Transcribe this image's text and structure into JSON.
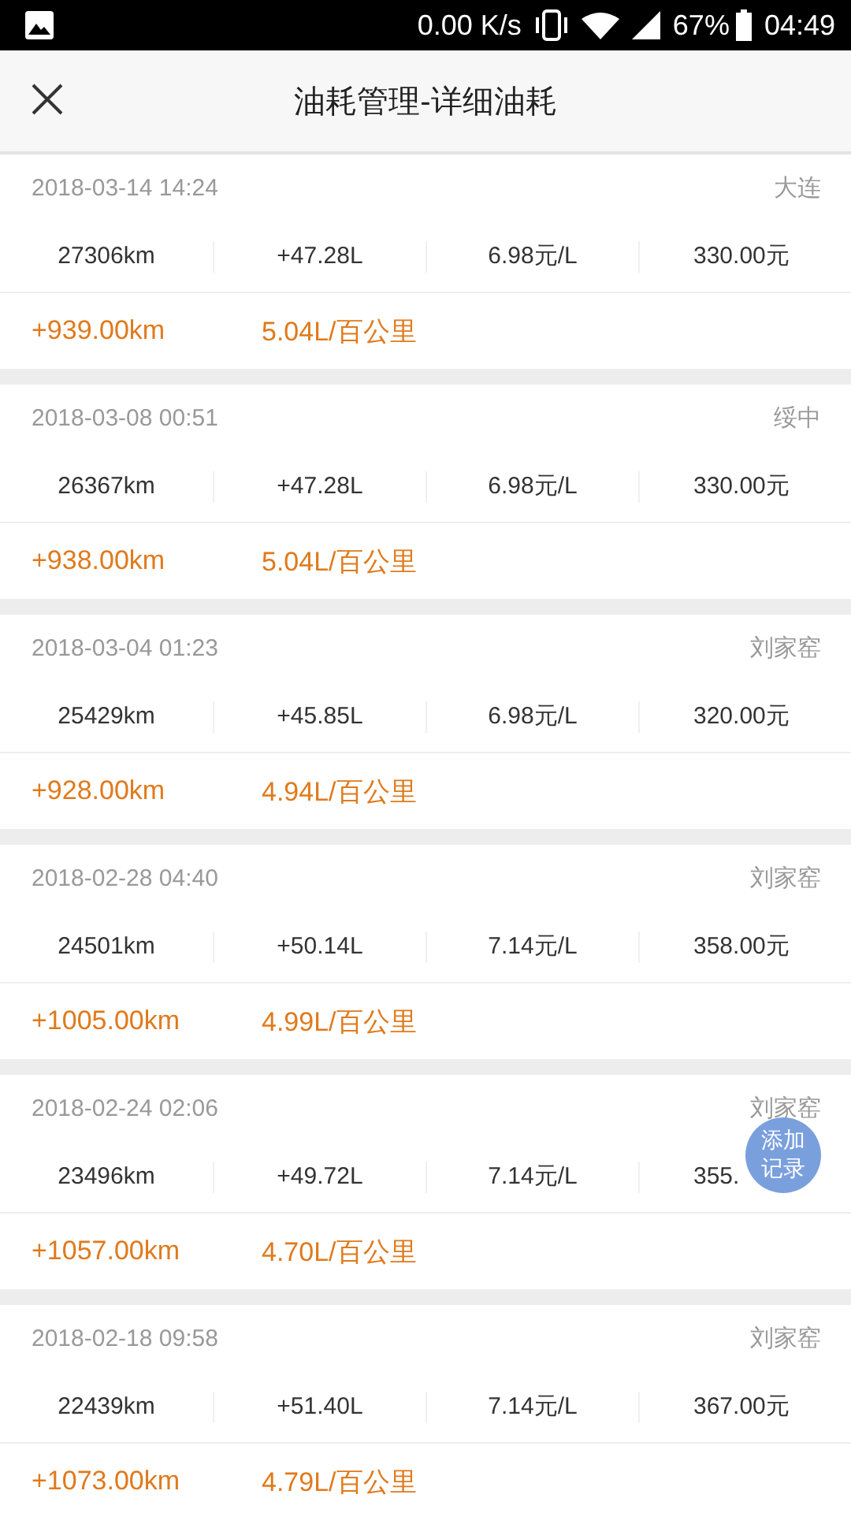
{
  "status_bar": {
    "speed": "0.00 K/s",
    "battery": "67%",
    "time": "04:49"
  },
  "header": {
    "title": "油耗管理-详细油耗"
  },
  "records": [
    {
      "datetime": "2018-03-14 14:24",
      "place": "大连",
      "odometer": "27306km",
      "fuel": "+47.28L",
      "price": "6.98元/L",
      "amount": "330.00元",
      "distance": "+939.00km",
      "consumption": "5.04L/百公里"
    },
    {
      "datetime": "2018-03-08 00:51",
      "place": "绥中",
      "odometer": "26367km",
      "fuel": "+47.28L",
      "price": "6.98元/L",
      "amount": "330.00元",
      "distance": "+938.00km",
      "consumption": "5.04L/百公里"
    },
    {
      "datetime": "2018-03-04 01:23",
      "place": "刘家窑",
      "odometer": "25429km",
      "fuel": "+45.85L",
      "price": "6.98元/L",
      "amount": "320.00元",
      "distance": "+928.00km",
      "consumption": "4.94L/百公里"
    },
    {
      "datetime": "2018-02-28 04:40",
      "place": "刘家窑",
      "odometer": "24501km",
      "fuel": "+50.14L",
      "price": "7.14元/L",
      "amount": "358.00元",
      "distance": "+1005.00km",
      "consumption": "4.99L/百公里"
    },
    {
      "datetime": "2018-02-24 02:06",
      "place": "刘家窑",
      "odometer": "23496km",
      "fuel": "+49.72L",
      "price": "7.14元/L",
      "amount": "355.",
      "distance": "+1057.00km",
      "consumption": "4.70L/百公里"
    },
    {
      "datetime": "2018-02-18 09:58",
      "place": "刘家窑",
      "odometer": "22439km",
      "fuel": "+51.40L",
      "price": "7.14元/L",
      "amount": "367.00元",
      "distance": "+1073.00km",
      "consumption": "4.79L/百公里"
    }
  ],
  "fab": {
    "label_line_1": "添加",
    "label_line_2": "记录"
  }
}
